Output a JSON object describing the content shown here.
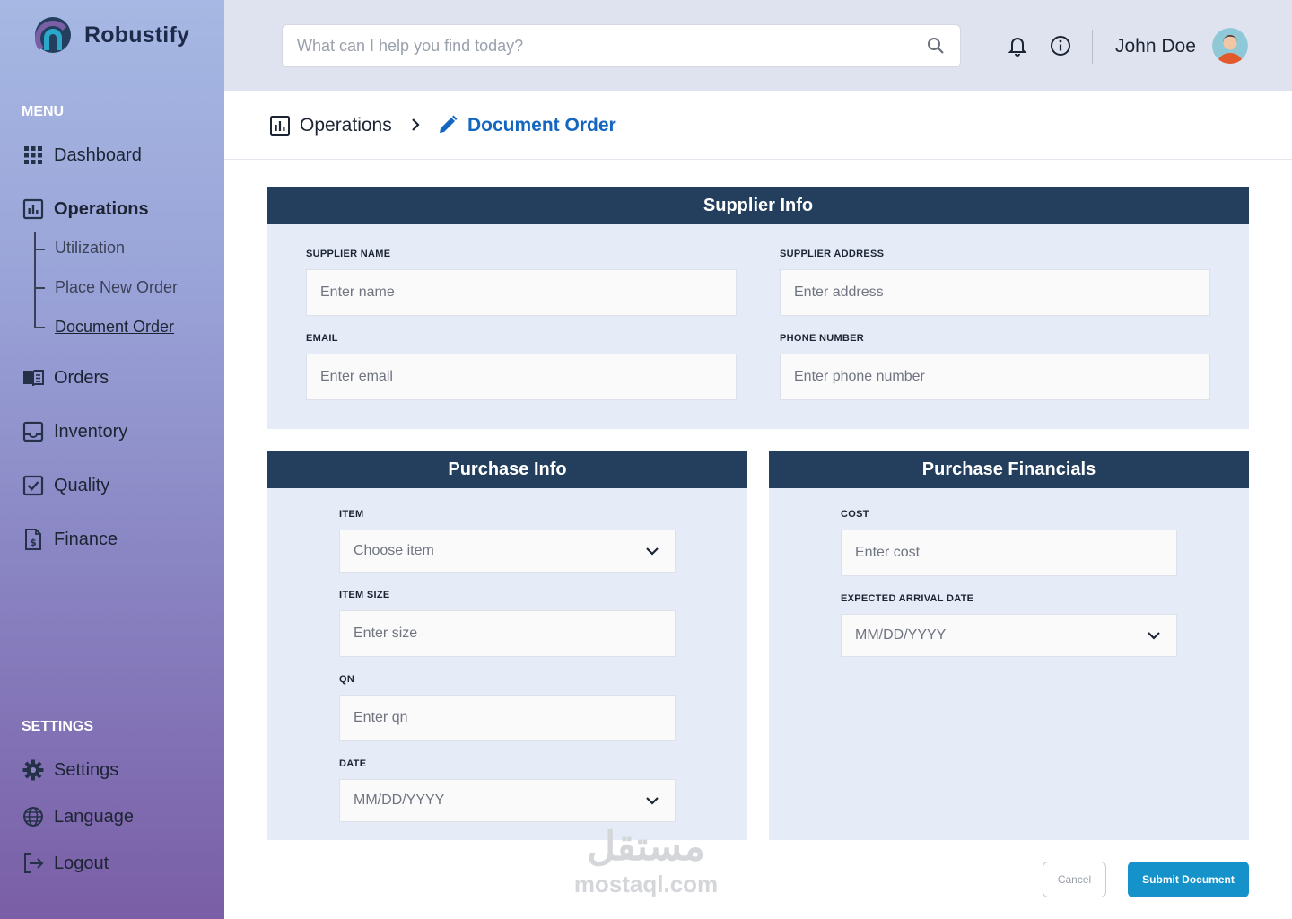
{
  "brand": {
    "name": "Robustify"
  },
  "sidebar": {
    "menu_label": "MENU",
    "settings_label": "SETTINGS",
    "items": [
      {
        "label": "Dashboard",
        "icon": "grid-icon"
      },
      {
        "label": "Operations",
        "icon": "chart-box-icon"
      },
      {
        "label": "Orders",
        "icon": "book-icon"
      },
      {
        "label": "Inventory",
        "icon": "inbox-icon"
      },
      {
        "label": "Quality",
        "icon": "checkbox-icon"
      },
      {
        "label": "Finance",
        "icon": "invoice-icon"
      }
    ],
    "sub_items": [
      {
        "label": "Utilization"
      },
      {
        "label": "Place New Order"
      },
      {
        "label": "Document Order"
      }
    ],
    "settings_items": [
      {
        "label": "Settings",
        "icon": "gear-icon"
      },
      {
        "label": "Language",
        "icon": "globe-icon"
      },
      {
        "label": "Logout",
        "icon": "logout-icon"
      }
    ]
  },
  "header": {
    "search_placeholder": "What can I help you find today?",
    "user_name": "John Doe"
  },
  "breadcrumb": {
    "parent": "Operations",
    "current": "Document Order"
  },
  "supplier_info": {
    "title": "Supplier Info",
    "name_label": "SUPPLIER NAME",
    "name_placeholder": "Enter name",
    "address_label": "SUPPLIER ADDRESS",
    "address_placeholder": "Enter address",
    "email_label": "EMAIL",
    "email_placeholder": "Enter email",
    "phone_label": "PHONE NUMBER",
    "phone_placeholder": "Enter phone number"
  },
  "purchase_info": {
    "title": "Purchase Info",
    "item_label": "ITEM",
    "item_value": "Choose item",
    "size_label": "ITEM SIZE",
    "size_placeholder": "Enter size",
    "qn_label": "QN",
    "qn_placeholder": "Enter qn",
    "date_label": "DATE",
    "date_value": "MM/DD/YYYY"
  },
  "purchase_financials": {
    "title": "Purchase Financials",
    "cost_label": "COST",
    "cost_placeholder": "Enter cost",
    "arrival_label": "EXPECTED ARRIVAL DATE",
    "arrival_value": "MM/DD/YYYY"
  },
  "actions": {
    "cancel": "Cancel",
    "submit": "Submit Document"
  },
  "watermark": {
    "arabic": "مستقل",
    "latin": "mostaql.com"
  },
  "colors": {
    "panel_header": "#243f5e",
    "panel_bg": "#e5ebf7",
    "accent": "#1566c0",
    "submit": "#1592c9"
  }
}
